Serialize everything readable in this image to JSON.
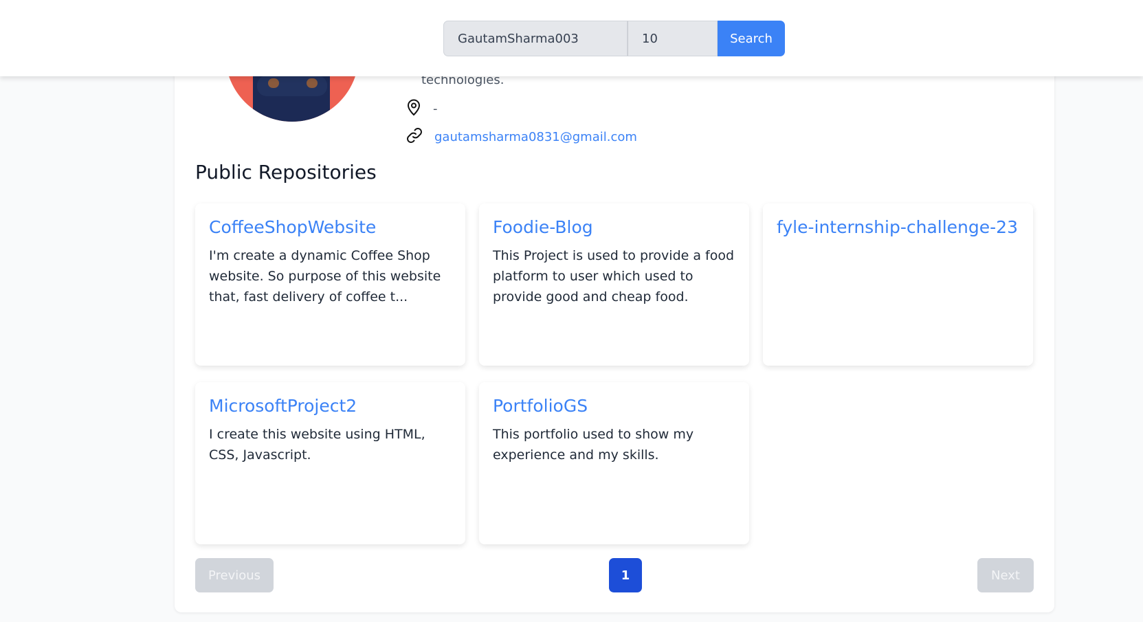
{
  "search": {
    "username_value": "GautamSharma003",
    "per_page_value": "10",
    "button_label": "Search"
  },
  "profile": {
    "bio_tail": "technologies.",
    "location": "-",
    "link": "gautamsharma0831@gmail.com"
  },
  "section_title": "Public Repositories",
  "repos": [
    {
      "name": "CoffeeShopWebsite",
      "description": "I'm create a dynamic Coffee Shop website. So purpose of this website that, fast delivery of coffee t..."
    },
    {
      "name": "Foodie-Blog",
      "description": "This Project is used to provide a food platform to user which used to provide good and cheap food."
    },
    {
      "name": "fyle-internship-challenge-23",
      "description": ""
    },
    {
      "name": "MicrosoftProject2",
      "description": "I create this website using HTML, CSS, Javascript."
    },
    {
      "name": "PortfolioGS",
      "description": "This portfolio used to show my experience and my skills."
    }
  ],
  "pagination": {
    "previous_label": "Previous",
    "current_page": "1",
    "next_label": "Next"
  },
  "colors": {
    "accent": "#3b82f6",
    "active_page": "#1d4ed8",
    "disabled": "#d1d5db",
    "avatar_bg": "#ee6152"
  }
}
